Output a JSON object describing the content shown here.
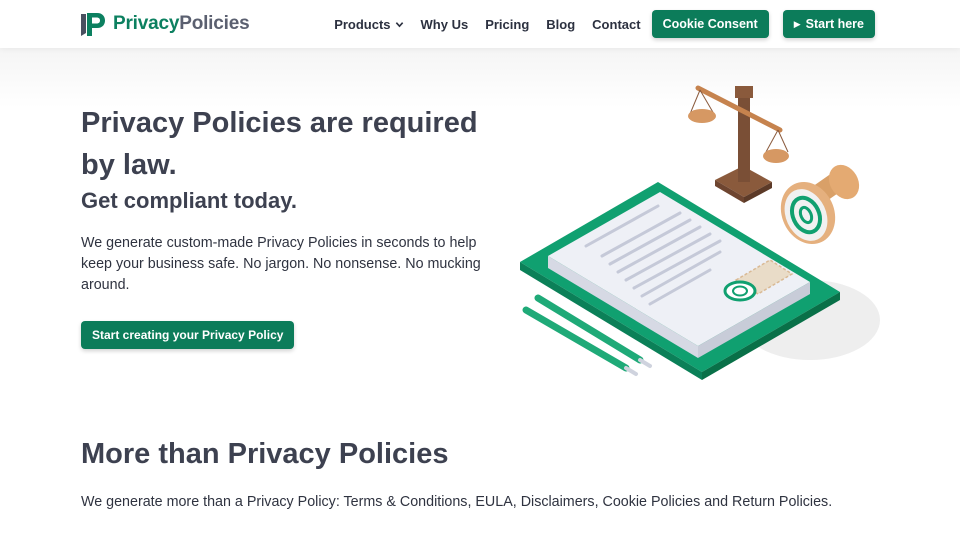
{
  "header": {
    "logo_prefix": "Privacy",
    "logo_suffix": "Policies",
    "nav": {
      "products": "Products",
      "why_us": "Why Us",
      "pricing": "Pricing",
      "blog": "Blog",
      "contact": "Contact"
    },
    "cookie_consent": "Cookie Consent",
    "start_here": "Start here",
    "start_icon": "▶"
  },
  "hero": {
    "title": "Privacy Policies are required by law.",
    "subtitle": "Get compliant today.",
    "text": "We generate custom-made Privacy Policies in seconds to help keep your business safe. No jargon. No nonsense. No mucking around.",
    "cta": "Start creating your Privacy Policy"
  },
  "section": {
    "title": "More than Privacy Policies",
    "text": "We generate more than a Privacy Policy: Terms & Conditions, EULA, Disclaimers, Cookie Policies and Return Policies."
  },
  "colors": {
    "brand_green": "#0c7c5a",
    "text_dark": "#3d4150"
  },
  "icons": [
    "logo-icon",
    "chevron-down-icon",
    "play-icon",
    "scales-icon",
    "stamp-icon",
    "pen-icon",
    "document-icon",
    "seal-icon"
  ]
}
